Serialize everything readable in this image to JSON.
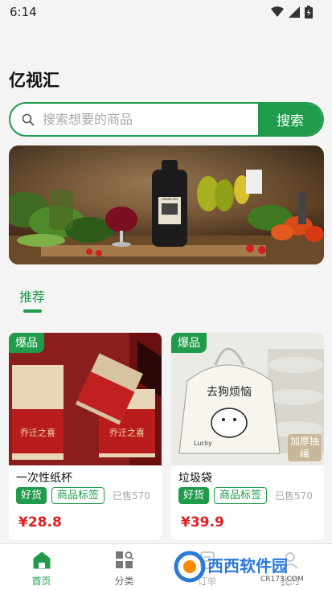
{
  "status_bar": {
    "time": "6:14",
    "icons": [
      "wifi-icon",
      "signal-icon",
      "battery-icon"
    ]
  },
  "app": {
    "title": "亿视汇"
  },
  "search": {
    "placeholder": "搜索想要的商品",
    "button_label": "搜索"
  },
  "banner": {
    "label": "GRAND VIN"
  },
  "tabs": [
    {
      "label": "推荐",
      "active": true
    }
  ],
  "products": [
    {
      "badge": "爆品",
      "name": "一次性纸杯",
      "tags": [
        "好货",
        "商品标签"
      ],
      "sold": "已售570",
      "price": "¥28.8",
      "image_text": "乔迁之喜"
    },
    {
      "badge": "爆品",
      "name": "垃圾袋",
      "tags": [
        "好货",
        "商品标签"
      ],
      "sold": "已售570",
      "price": "¥39.9",
      "image_text": "去狗烦恼",
      "image_sub": "Lucky",
      "image_corner": "加厚抽绳"
    }
  ],
  "bottom_nav": [
    {
      "label": "首页",
      "icon": "home-icon",
      "active": true
    },
    {
      "label": "分类",
      "icon": "category-icon",
      "active": false
    },
    {
      "label": "订单",
      "icon": "orders-icon",
      "active": false
    },
    {
      "label": "我的",
      "icon": "profile-icon",
      "active": false
    }
  ],
  "watermark": {
    "brand": "西西软件园",
    "site": "CR173.COM"
  },
  "colors": {
    "accent": "#1f9b4b",
    "price": "#e02020"
  }
}
